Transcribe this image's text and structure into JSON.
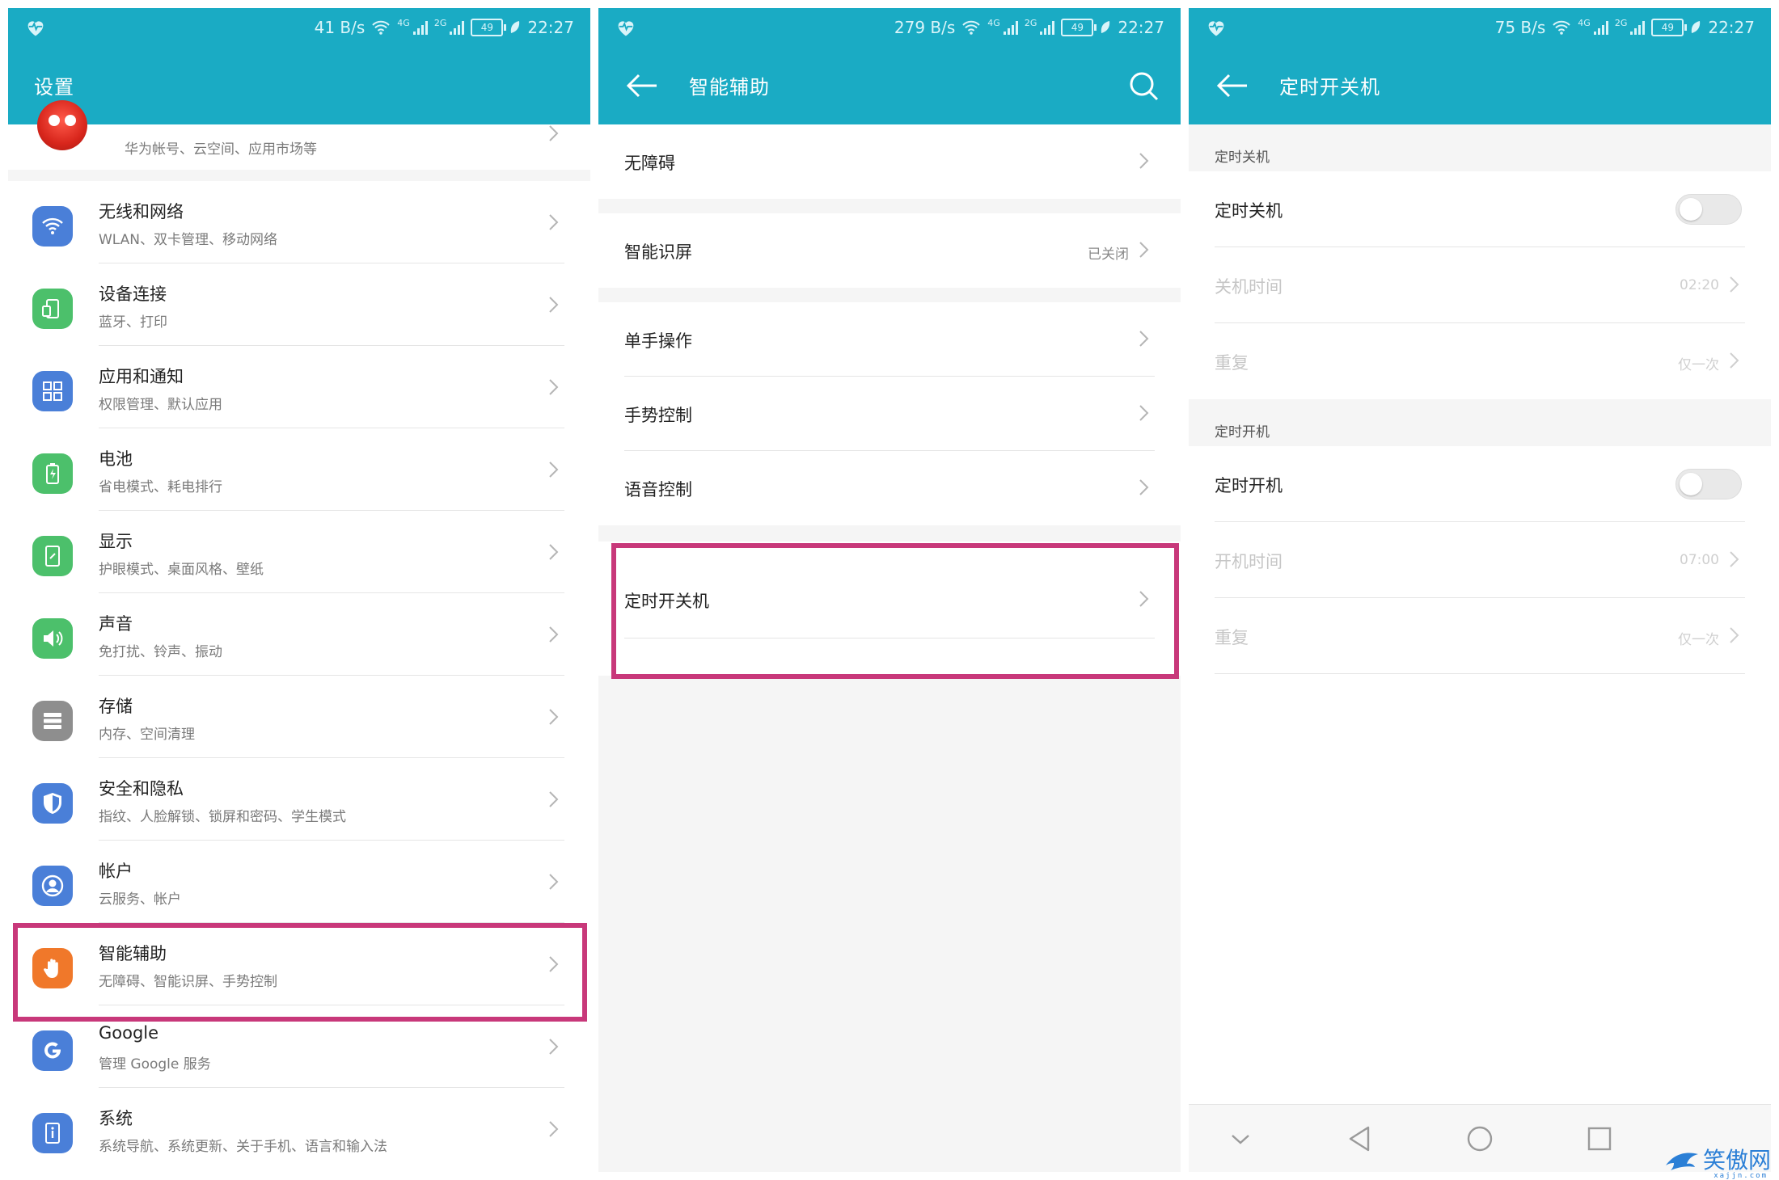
{
  "status": {
    "screen1": {
      "speed": "41 B/s",
      "battery": "49",
      "time": "22:27"
    },
    "screen2": {
      "speed": "279 B/s",
      "battery": "49",
      "time": "22:27"
    },
    "screen3": {
      "speed": "75 B/s",
      "battery": "49",
      "time": "22:27"
    },
    "net_tags": {
      "sim1": "4G",
      "sim2": "2G"
    }
  },
  "screen1": {
    "title": "设置",
    "profile_sub": "华为帐号、云空间、应用市场等",
    "items": [
      {
        "title": "无线和网络",
        "sub": "WLAN、双卡管理、移动网络",
        "icon": "wifi-icon",
        "color": "#4a7fd8"
      },
      {
        "title": "设备连接",
        "sub": "蓝牙、打印",
        "icon": "device-connect-icon",
        "color": "#4cc06b"
      },
      {
        "title": "应用和通知",
        "sub": "权限管理、默认应用",
        "icon": "apps-grid-icon",
        "color": "#4a7fd8"
      },
      {
        "title": "电池",
        "sub": "省电模式、耗电排行",
        "icon": "battery-icon",
        "color": "#4cc06b"
      },
      {
        "title": "显示",
        "sub": "护眼模式、桌面风格、壁纸",
        "icon": "display-icon",
        "color": "#4cc06b"
      },
      {
        "title": "声音",
        "sub": "免打扰、铃声、振动",
        "icon": "speaker-icon",
        "color": "#4cc06b"
      },
      {
        "title": "存储",
        "sub": "内存、空间清理",
        "icon": "storage-icon",
        "color": "#8e8e8e"
      },
      {
        "title": "安全和隐私",
        "sub": "指纹、人脸解锁、锁屏和密码、学生模式",
        "icon": "shield-icon",
        "color": "#4a7fd8"
      },
      {
        "title": "帐户",
        "sub": "云服务、帐户",
        "icon": "account-icon",
        "color": "#4a7fd8"
      },
      {
        "title": "智能辅助",
        "sub": "无障碍、智能识屏、手势控制",
        "icon": "hand-icon",
        "color": "#f0782a"
      },
      {
        "title": "Google",
        "sub": "管理 Google 服务",
        "icon": "google-icon",
        "color": "#4a7fd8"
      },
      {
        "title": "系统",
        "sub": "系统导航、系统更新、关于手机、语言和输入法",
        "icon": "system-info-icon",
        "color": "#4a7fd8"
      }
    ]
  },
  "screen2": {
    "title": "智能辅助",
    "items": {
      "accessibility": "无障碍",
      "smart_screen": "智能识屏",
      "smart_screen_value": "已关闭",
      "one_hand": "单手操作",
      "gesture": "手势控制",
      "voice": "语音控制",
      "schedule_power": "定时开关机"
    }
  },
  "screen3": {
    "title": "定时开关机",
    "off_section": "定时关机",
    "off_toggle": "定时关机",
    "off_time_label": "关机时间",
    "off_time": "02:20",
    "off_repeat_label": "重复",
    "off_repeat": "仅一次",
    "on_section": "定时开机",
    "on_toggle": "定时开机",
    "on_time_label": "开机时间",
    "on_time": "07:00",
    "on_repeat_label": "重复",
    "on_repeat": "仅一次"
  },
  "watermark": {
    "text": "笑傲网",
    "sub": "xajjn.com"
  },
  "colors": {
    "appbar": "#1aabc4",
    "highlight": "#c8387a"
  }
}
